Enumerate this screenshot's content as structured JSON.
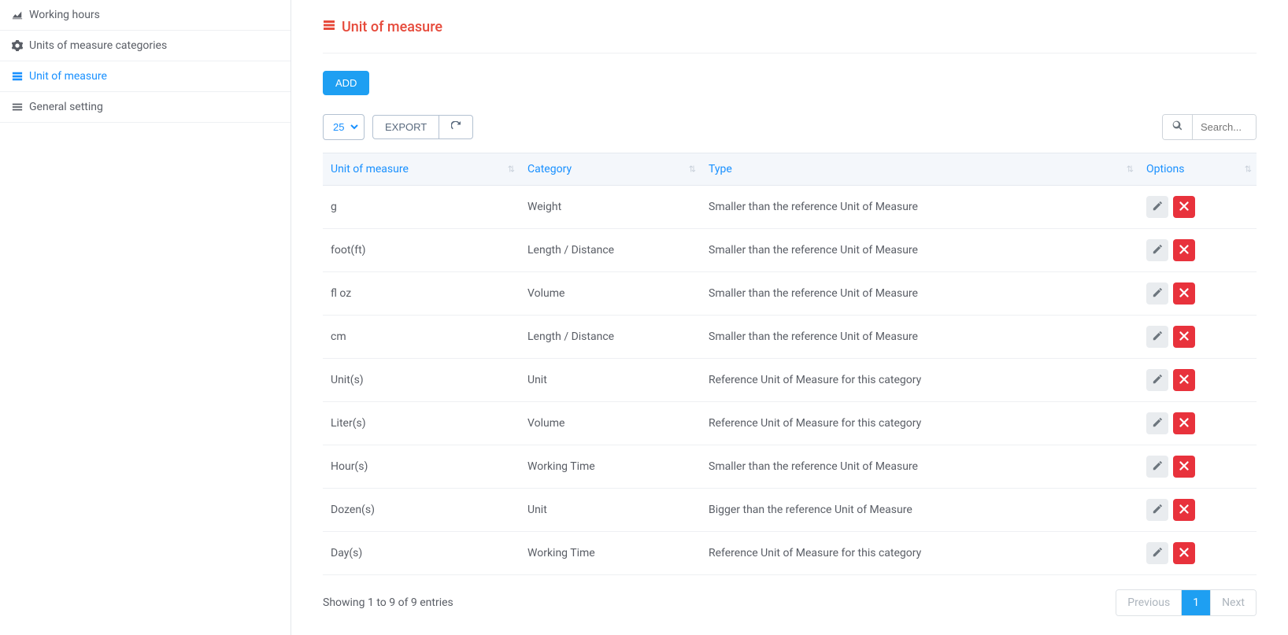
{
  "sidebar": {
    "items": [
      {
        "label": "Working hours",
        "icon": "area-chart",
        "active": false
      },
      {
        "label": "Units of measure categories",
        "icon": "gear",
        "active": false
      },
      {
        "label": "Unit of measure",
        "icon": "list",
        "active": true
      },
      {
        "label": "General setting",
        "icon": "menu",
        "active": false
      }
    ]
  },
  "page": {
    "title": "Unit of measure",
    "add_label": "ADD",
    "export_label": "EXPORT",
    "page_size": "25",
    "search_placeholder": "Search...",
    "showing_text": "Showing 1 to 9 of 9 entries",
    "prev_label": "Previous",
    "next_label": "Next",
    "current_page": "1"
  },
  "table": {
    "headers": {
      "unit": "Unit of measure",
      "category": "Category",
      "type": "Type",
      "options": "Options"
    },
    "rows": [
      {
        "unit": "g",
        "category": "Weight",
        "type": "Smaller than the reference Unit of Measure"
      },
      {
        "unit": "foot(ft)",
        "category": "Length / Distance",
        "type": "Smaller than the reference Unit of Measure"
      },
      {
        "unit": "fl oz",
        "category": "Volume",
        "type": "Smaller than the reference Unit of Measure"
      },
      {
        "unit": "cm",
        "category": "Length / Distance",
        "type": "Smaller than the reference Unit of Measure"
      },
      {
        "unit": "Unit(s)",
        "category": "Unit",
        "type": "Reference Unit of Measure for this category"
      },
      {
        "unit": "Liter(s)",
        "category": "Volume",
        "type": "Reference Unit of Measure for this category"
      },
      {
        "unit": "Hour(s)",
        "category": "Working Time",
        "type": "Smaller than the reference Unit of Measure"
      },
      {
        "unit": "Dozen(s)",
        "category": "Unit",
        "type": "Bigger than the reference Unit of Measure"
      },
      {
        "unit": "Day(s)",
        "category": "Working Time",
        "type": "Reference Unit of Measure for this category"
      }
    ]
  }
}
